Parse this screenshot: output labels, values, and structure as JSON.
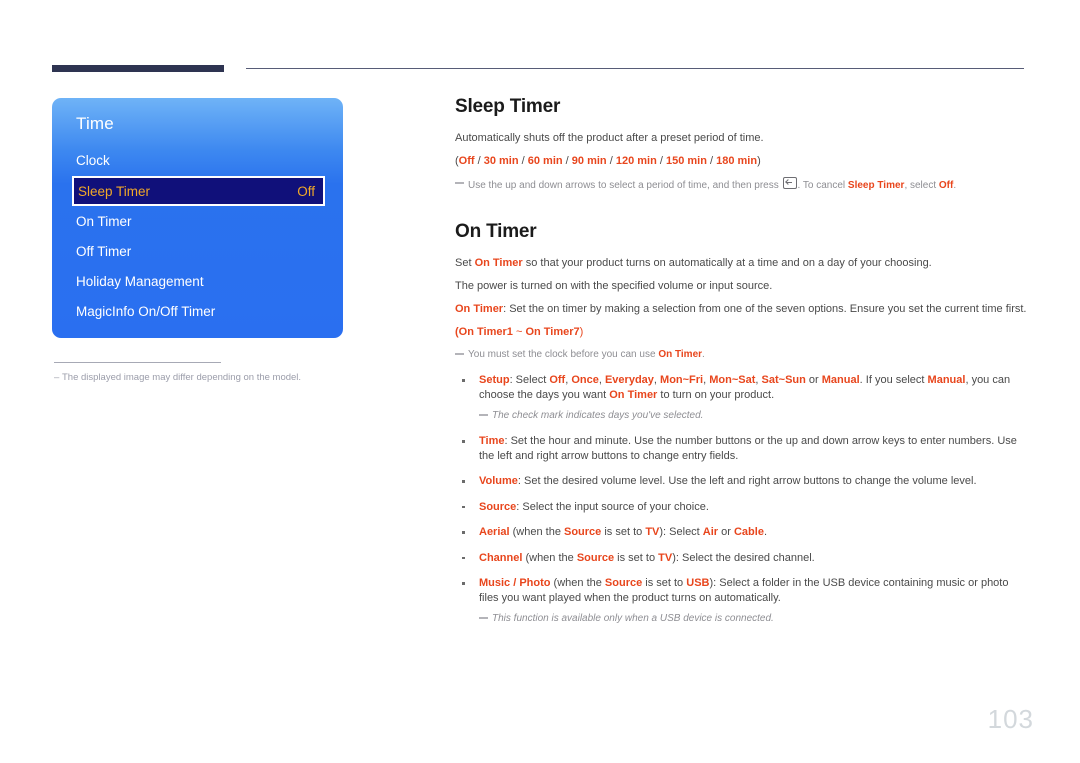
{
  "page": {
    "number": "103"
  },
  "osd": {
    "title": "Time",
    "items": [
      {
        "label": "Clock",
        "value": "",
        "selected": false
      },
      {
        "label": "Sleep Timer",
        "value": "Off",
        "selected": true
      },
      {
        "label": "On Timer",
        "value": "",
        "selected": false
      },
      {
        "label": "Off Timer",
        "value": "",
        "selected": false
      },
      {
        "label": "Holiday Management",
        "value": "",
        "selected": false
      },
      {
        "label": "MagicInfo On/Off Timer",
        "value": "",
        "selected": false
      }
    ],
    "footnote": "The displayed image may differ depending on the model.",
    "colors": {
      "panel_top": "#6fb3f7",
      "panel_bottom": "#2a6ff0",
      "selected_bg": "#10107a",
      "selected_text": "#f0a829"
    }
  },
  "sleep_timer": {
    "title": "Sleep Timer",
    "description": "Automatically shuts off the product after a preset period of time.",
    "options_prefix": "(",
    "options": [
      "Off",
      "30 min",
      "60 min",
      "90 min",
      "120 min",
      "150 min",
      "180 min"
    ],
    "options_separator": " / ",
    "options_suffix": ")",
    "note": {
      "part1": "Use the up and down arrows to select a period of time, and then press ",
      "icon": "enter-key-icon",
      "part2": ". To cancel ",
      "emphasis1": "Sleep Timer",
      "part3": ", select ",
      "emphasis2": "Off",
      "part4": "."
    }
  },
  "on_timer": {
    "title": "On Timer",
    "intro1_a": "Set ",
    "intro1_b": "On Timer",
    "intro1_c": " so that your product turns on automatically at a time and on a day of your choosing.",
    "intro2": "The power is turned on with the specified volume or input source.",
    "intro3_a": "On Timer",
    "intro3_b": ": Set the on timer by making a selection from one of the seven options. Ensure you set the current time first.",
    "range_line": {
      "prefix": "(",
      "first": "On Timer1",
      "tilde": " ~ ",
      "last": "On Timer7",
      "suffix": ")"
    },
    "note_clock": {
      "part1": "You must set the clock before you can use ",
      "emphasis": "On Timer",
      "part2": "."
    },
    "bullets": [
      {
        "name": "setup",
        "segments": [
          {
            "t": "Setup",
            "s": "red"
          },
          {
            "t": ": Select ",
            "s": "plain"
          },
          {
            "t": "Off",
            "s": "red"
          },
          {
            "t": ", ",
            "s": "plain"
          },
          {
            "t": "Once",
            "s": "red"
          },
          {
            "t": ", ",
            "s": "plain"
          },
          {
            "t": "Everyday",
            "s": "red"
          },
          {
            "t": ", ",
            "s": "plain"
          },
          {
            "t": "Mon~Fri",
            "s": "red"
          },
          {
            "t": ", ",
            "s": "plain"
          },
          {
            "t": "Mon~Sat",
            "s": "red"
          },
          {
            "t": ", ",
            "s": "plain"
          },
          {
            "t": "Sat~Sun",
            "s": "red"
          },
          {
            "t": " or ",
            "s": "plain"
          },
          {
            "t": "Manual",
            "s": "red"
          },
          {
            "t": ". If you select ",
            "s": "plain"
          },
          {
            "t": "Manual",
            "s": "red"
          },
          {
            "t": ", you can choose the days you want ",
            "s": "plain"
          },
          {
            "t": "On Timer",
            "s": "red"
          },
          {
            "t": " to turn on your product.",
            "s": "plain"
          }
        ],
        "note": "The check mark indicates days you've selected."
      },
      {
        "name": "time",
        "segments": [
          {
            "t": "Time",
            "s": "red"
          },
          {
            "t": ": Set the hour and minute. Use the number buttons or the up and down arrow keys to enter numbers. Use the left and right arrow buttons to change entry fields.",
            "s": "plain"
          }
        ],
        "note": ""
      },
      {
        "name": "volume",
        "segments": [
          {
            "t": "Volume",
            "s": "red"
          },
          {
            "t": ": Set the desired volume level. Use the left and right arrow buttons to change the volume level.",
            "s": "plain"
          }
        ],
        "note": ""
      },
      {
        "name": "source",
        "segments": [
          {
            "t": "Source",
            "s": "red"
          },
          {
            "t": ": Select the input source of your choice.",
            "s": "plain"
          }
        ],
        "note": ""
      },
      {
        "name": "aerial",
        "segments": [
          {
            "t": "Aerial",
            "s": "red"
          },
          {
            "t": " (when the ",
            "s": "plain"
          },
          {
            "t": "Source",
            "s": "red"
          },
          {
            "t": " is set to ",
            "s": "plain"
          },
          {
            "t": "TV",
            "s": "red"
          },
          {
            "t": "): Select ",
            "s": "plain"
          },
          {
            "t": "Air",
            "s": "red"
          },
          {
            "t": " or ",
            "s": "plain"
          },
          {
            "t": "Cable",
            "s": "red"
          },
          {
            "t": ".",
            "s": "plain"
          }
        ],
        "note": ""
      },
      {
        "name": "channel",
        "segments": [
          {
            "t": "Channel",
            "s": "red"
          },
          {
            "t": " (when the ",
            "s": "plain"
          },
          {
            "t": "Source",
            "s": "red"
          },
          {
            "t": " is set to ",
            "s": "plain"
          },
          {
            "t": "TV",
            "s": "red"
          },
          {
            "t": "): Select the desired channel.",
            "s": "plain"
          }
        ],
        "note": ""
      },
      {
        "name": "music-photo",
        "segments": [
          {
            "t": "Music / Photo",
            "s": "red"
          },
          {
            "t": " (when the ",
            "s": "plain"
          },
          {
            "t": "Source",
            "s": "red"
          },
          {
            "t": " is set to ",
            "s": "plain"
          },
          {
            "t": "USB",
            "s": "red"
          },
          {
            "t": "): Select a folder in the USB device containing music or photo files you want played when the product turns on automatically.",
            "s": "plain"
          }
        ],
        "note": "This function is available only when a USB device is connected."
      }
    ]
  }
}
